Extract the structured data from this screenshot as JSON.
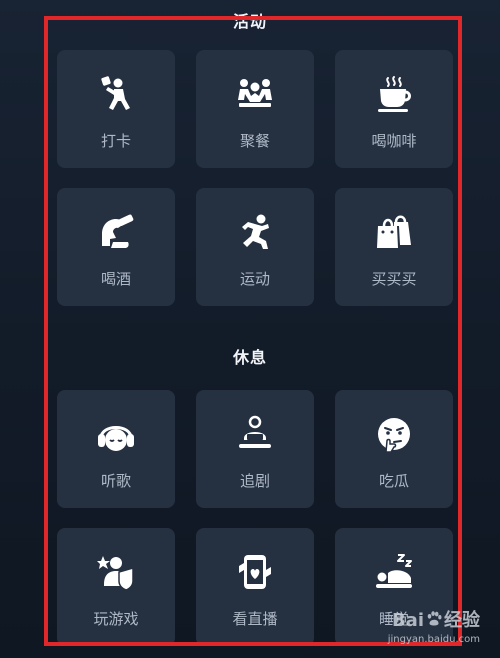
{
  "sections": {
    "activity": {
      "title": "活动",
      "items": [
        {
          "label": "打卡",
          "icon": "check-in-icon"
        },
        {
          "label": "聚餐",
          "icon": "group-dinner-icon"
        },
        {
          "label": "喝咖啡",
          "icon": "coffee-cup-icon"
        },
        {
          "label": "喝酒",
          "icon": "drinking-icon"
        },
        {
          "label": "运动",
          "icon": "running-icon"
        },
        {
          "label": "买买买",
          "icon": "shopping-bag-icon"
        }
      ]
    },
    "rest": {
      "title": "休息",
      "items": [
        {
          "label": "听歌",
          "icon": "headphones-icon"
        },
        {
          "label": "追剧",
          "icon": "watching-tv-icon"
        },
        {
          "label": "吃瓜",
          "icon": "curious-face-icon"
        },
        {
          "label": "玩游戏",
          "icon": "gaming-icon"
        },
        {
          "label": "看直播",
          "icon": "live-stream-icon"
        },
        {
          "label": "睡觉",
          "icon": "sleeping-icon"
        }
      ]
    }
  },
  "watermark": {
    "brand_left": "Bai",
    "brand_right": "经验",
    "url": "jingyan.baidu.com"
  },
  "colors": {
    "tile_background": "#253141",
    "icon": "#ffffff",
    "label": "#aeb8c6",
    "highlight_frame": "#e0282b"
  }
}
